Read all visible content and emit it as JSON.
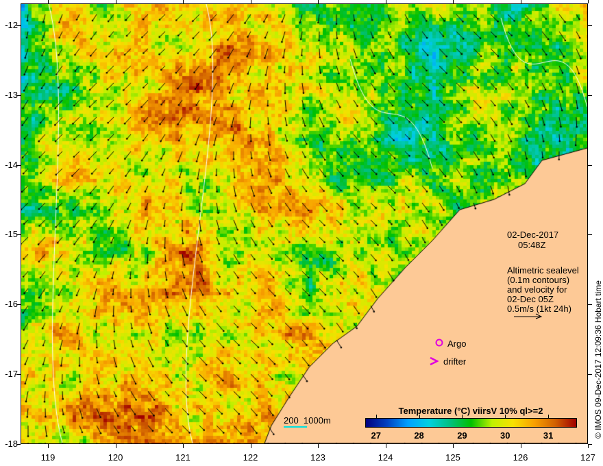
{
  "timestamp": {
    "date": "02-Dec-2017",
    "time": "05:48Z"
  },
  "legend_text": [
    "Altimetric sealevel",
    "(0.1m contours)",
    "and velocity for",
    "02-Dec 05Z",
    "0.5m/s (1kt 24h)"
  ],
  "markers": {
    "argo": "Argo",
    "drifter": "drifter"
  },
  "scale_label": "200  1000m",
  "colorbar": {
    "title": "Temperature (°C) viirsV 10% ql>=2",
    "ticks": [
      "27",
      "28",
      "29",
      "30",
      "31"
    ],
    "range": [
      26.75,
      31.65
    ]
  },
  "axes": {
    "lon_ticks": [
      "119",
      "120",
      "121",
      "122",
      "123",
      "124",
      "125",
      "126",
      "127"
    ],
    "lat_ticks": [
      "-12",
      "-13",
      "-14",
      "-15",
      "-16",
      "-17",
      "-18"
    ]
  },
  "credit": "© IMOS 09-Dec-2017 12:09:36 Hobart time",
  "colors": {
    "land": "#fdc996",
    "contour": "#ffffff",
    "marker": "#e000e0"
  }
}
